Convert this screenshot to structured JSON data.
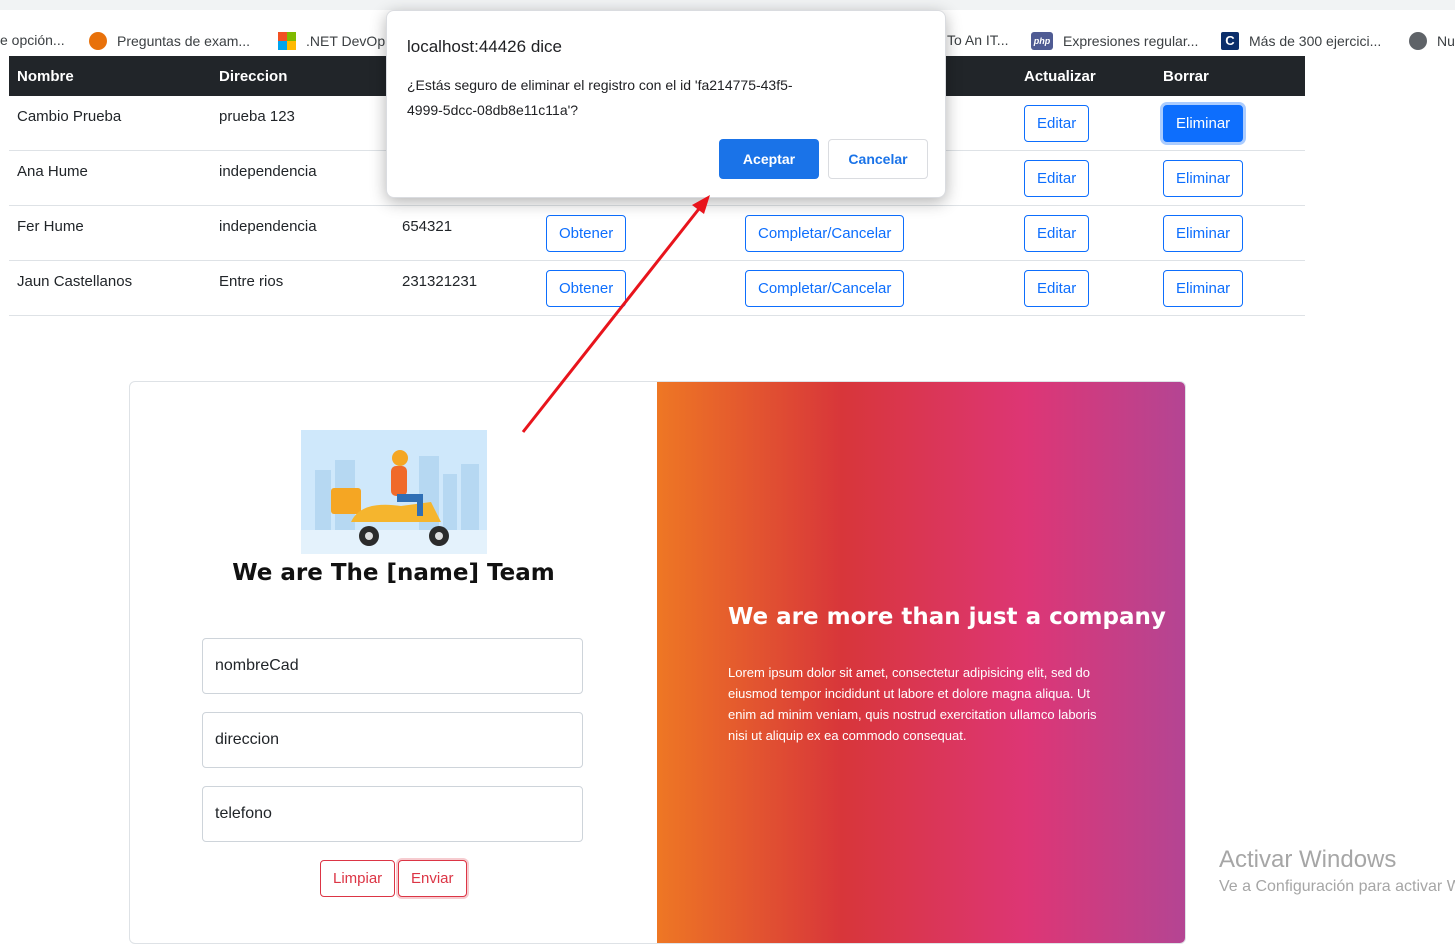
{
  "bookmarks": [
    {
      "label": "e opción...",
      "icon": "none"
    },
    {
      "label": "Preguntas de exam...",
      "icon": "quiz-icon"
    },
    {
      "label": ".NET DevOp",
      "icon": "microsoft-icon"
    },
    {
      "label": "To An IT...",
      "icon": "none"
    },
    {
      "label": "Expresiones regular...",
      "icon": "php-icon"
    },
    {
      "label": "Más de 300 ejercici...",
      "icon": "c-icon"
    },
    {
      "label": "Nu",
      "icon": "globe-icon"
    }
  ],
  "table": {
    "headers": [
      "Nombre",
      "Direccion",
      "",
      "",
      "",
      "Actualizar",
      "Borrar"
    ],
    "rows": [
      {
        "nombre": "Cambio Prueba",
        "direccion": "prueba 123",
        "telefono": "",
        "obtener": "",
        "completar": "",
        "editar": "Editar",
        "eliminar": "Eliminar"
      },
      {
        "nombre": "Ana Hume",
        "direccion": "independencia",
        "telefono": "",
        "obtener": "",
        "completar": "",
        "editar": "Editar",
        "eliminar": "Eliminar"
      },
      {
        "nombre": "Fer Hume",
        "direccion": "independencia",
        "telefono": "654321",
        "obtener": "Obtener",
        "completar": "Completar/Cancelar",
        "editar": "Editar",
        "eliminar": "Eliminar"
      },
      {
        "nombre": "Jaun Castellanos",
        "direccion": "Entre rios",
        "telefono": "231321231",
        "obtener": "Obtener",
        "completar": "Completar/Cancelar",
        "editar": "Editar",
        "eliminar": "Eliminar"
      }
    ]
  },
  "card": {
    "team_title": "We are The [name] Team",
    "fields": {
      "nombre": "nombreCad",
      "direccion": "direccion",
      "telefono": "telefono"
    },
    "clear_label": "Limpiar",
    "submit_label": "Enviar",
    "right_title": "We are more than just a company",
    "right_text": "Lorem ipsum dolor sit amet, consectetur adipisicing elit, sed do eiusmod tempor incididunt ut labore et dolore magna aliqua. Ut enim ad minim veniam, quis nostrud exercitation ullamco laboris nisi ut aliquip ex ea commodo consequat."
  },
  "dialog": {
    "title": "localhost:44426 dice",
    "message": "¿Estás seguro de eliminar el registro con el id 'fa214775-43f5-4999-5dcc-08db8e11c11a'?",
    "accept_label": "Aceptar",
    "cancel_label": "Cancelar"
  },
  "watermark": {
    "line1": "Activar Windows",
    "line2": "Ve a Configuración para activar Windows."
  },
  "colors": {
    "primary": "#0d6efd",
    "danger": "#dc3545",
    "dark": "#212529",
    "dialog_accent": "#1a73e8",
    "arrow": "#e8141c"
  }
}
